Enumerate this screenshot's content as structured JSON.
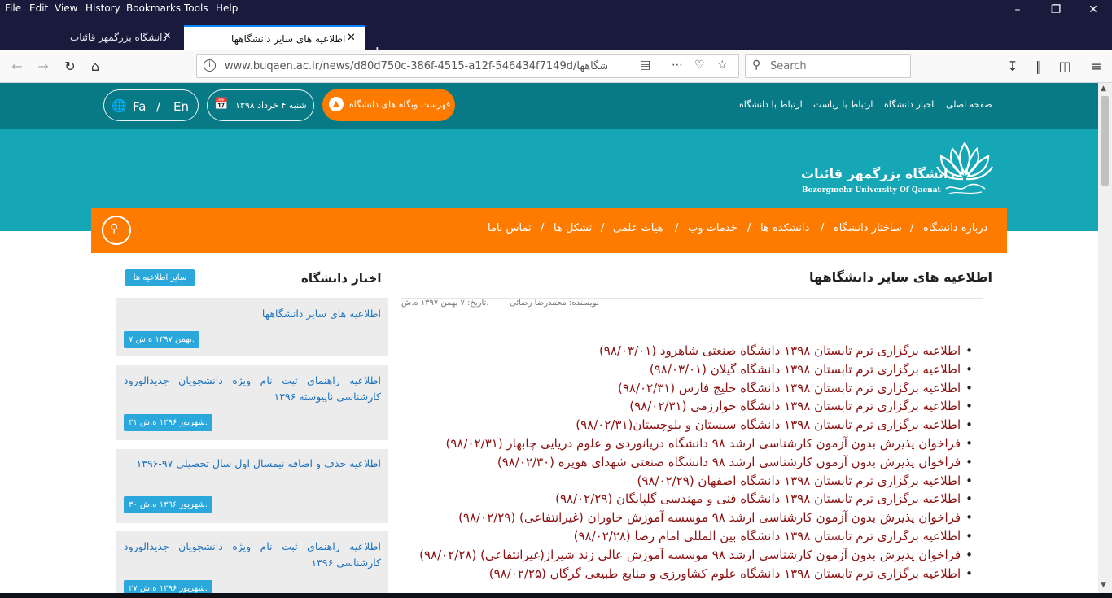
{
  "browser": {
    "menu": [
      "File",
      "Edit",
      "View",
      "History",
      "Bookmarks",
      "Tools",
      "Help"
    ],
    "tabs": [
      {
        "title": "دانشگاه بزرگمهر قائنات"
      },
      {
        "title": "اطلاعیه های سایر دانشگاهها"
      }
    ],
    "url": "www.buqaen.ac.ir/news/d80d750c-386f-4515-a12f-546434f7149d/اطلاعیه-های-سایر-دانشگاهها",
    "search_placeholder": "Search",
    "icons": {
      "back": "back-arrow-icon",
      "forward": "forward-arrow-icon",
      "reload": "reload-icon",
      "home": "home-icon",
      "info": "info-icon",
      "reader": "reader-view-icon",
      "more": "page-actions-icon",
      "pocket": "pocket-icon",
      "bookmark": "star-icon",
      "search": "search-icon",
      "download": "download-icon",
      "library": "library-icon",
      "sidebar": "sidebar-icon",
      "menu": "hamburger-menu-icon"
    }
  },
  "topbar": {
    "lang_fa": "Fa",
    "lang_sep": "/",
    "lang_en": "En",
    "date": "شنبه ۴ خرداد ۱۳۹۸",
    "sites_button": "فهرست وبگاه های دانشگاه",
    "links": [
      "صفحه اصلی",
      "اخبار دانشگاه",
      "ارتباط با ریاست",
      "ارتباط با دانشگاه"
    ]
  },
  "header": {
    "name_fa": "دانشگاه بزرگمهر قائنات",
    "name_en": "Bozorgmehr University Of Qaenat"
  },
  "mainnav": {
    "items": [
      "درباره دانشگاه",
      "ساختار دانشگاه",
      "دانشکده ها",
      "خدمات وب",
      "هیات علمی",
      "تشکل ها",
      "تماس باما"
    ],
    "separator": "/"
  },
  "article": {
    "title": "اطلاعیه های سایر دانشگاهها",
    "author": "نویسنده: محمدرضا رضائی",
    "date": "تاریخ: ۷ بهمن ۱۳۹۷ ه.ش.",
    "items": [
      "اطلاعیه برگزاری ترم تابستان ۱۳۹۸ دانشگاه صنعتی شاهرود (۹۸/۰۳/۰۱)",
      "اطلاعیه برگزاری ترم تابستان ۱۳۹۸ دانشگاه گیلان (۹۸/۰۳/۰۱)",
      "اطلاعیه برگزاری ترم تابستان ۱۳۹۸ دانشگاه خلیج فارس (۹۸/۰۲/۳۱)",
      "اطلاعیه برگزاری ترم تابستان ۱۳۹۸ دانشگاه خوارزمی (۹۸/۰۲/۳۱)",
      "اطلاعیه برگزاری ترم تابستان ۱۳۹۸ دانشگاه سیستان و بلوچستان(۹۸/۰۲/۳۱)",
      "فراخوان پذیرش بدون آزمون کارشناسی ارشد ۹۸ دانشگاه دریانوردی و علوم دریایی چابهار (۹۸/۰۲/۳۱)",
      "فراخوان پذیرش بدون آزمون کارشناسی ارشد ۹۸ دانشگاه صنعتی شهدای هویزه (۹۸/۰۲/۳۰)",
      "اطلاعیه برگزاری ترم تابستان ۱۳۹۸ دانشگاه اصفهان (۹۸/۰۲/۲۹)",
      "اطلاعیه برگزاری ترم تابستان ۱۳۹۸ دانشگاه فنی و مهندسی گلپایگان (۹۸/۰۲/۲۹)",
      "فراخوان پذیرش بدون آزمون کارشناسی ارشد ۹۸ موسسه آموزش خاوران (غیرانتفاعی) (۹۸/۰۲/۲۹)",
      "اطلاعیه برگزاری ترم تابستان ۱۳۹۸ دانشگاه بین المللی امام رضا (۹۸/۰۲/۲۸)",
      "فراخوان پذیرش بدون آزمون کارشناسی ارشد ۹۸ موسسه آموزش عالی زند شیراز(غیرانتفاعی) (۹۸/۰۲/۲۸)",
      "اطلاعیه برگزاری ترم تابستان ۱۳۹۸ دانشگاه علوم کشاورزی و منابع طبیعی گرگان (۹۸/۰۲/۲۵)"
    ]
  },
  "sidebar": {
    "title": "اخبار دانشگاه",
    "more_button": "سایر اطلاعیه ها",
    "news": [
      {
        "title": "اطلاعیه های سایر دانشگاهها",
        "date": "۷ بهمن ۱۳۹۷ ه.ش."
      },
      {
        "title": "اطلاعیه راهنمای ثبت نام ویژه دانشجویان جدیدالورود کارشناسی ناپیوسته ۱۳۹۶",
        "date": "۳۱ شهریور ۱۳۹۶ ه.ش."
      },
      {
        "title": "اطلاعیه حذف و اضافه نیمسال اول سال تحصیلی ۹۷-۱۳۹۶",
        "date": "۳۰ شهریور ۱۳۹۶ ه.ش."
      },
      {
        "title": "اطلاعیه راهنمای ثبت نام ویژه دانشجویان جدیدالورود کارشناسی ۱۳۹۶",
        "date": "۲۷ شهریور ۱۳۹۶ ه.ش."
      }
    ]
  },
  "colors": {
    "teal_dark": "#087a85",
    "teal": "#15a7b6",
    "orange": "#ff7b00",
    "link_blue": "#1e73be",
    "announce_red": "#8b1111",
    "badge_blue": "#2aa8dc"
  }
}
